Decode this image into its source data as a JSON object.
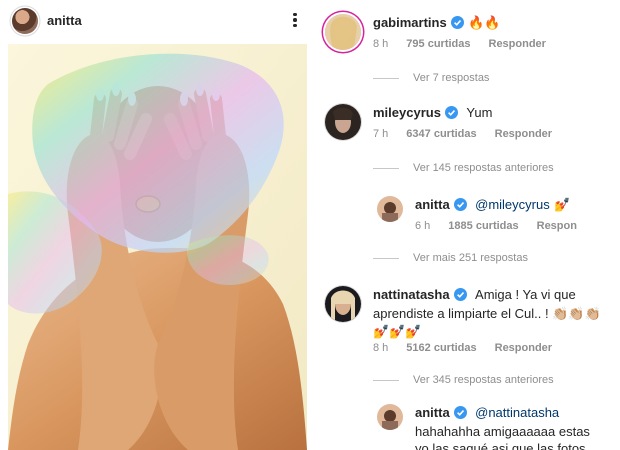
{
  "post": {
    "username": "anitta",
    "photo_alt": "anitta photo"
  },
  "comments": [
    {
      "username": "gabimartins",
      "text": "🔥🔥",
      "time": "8 h",
      "likes": "795 curtidas",
      "reply_label": "Responder",
      "view_replies": "Ver 7 respostas"
    },
    {
      "username": "mileycyrus",
      "text": "Yum",
      "time": "7 h",
      "likes": "6347 curtidas",
      "reply_label": "Responder",
      "view_replies": "Ver 145 respostas anteriores"
    },
    {
      "username": "anitta",
      "mention": "@mileycyrus",
      "text": "💅",
      "time": "6 h",
      "likes": "1885 curtidas",
      "reply_label": "Respon",
      "view_replies": "Ver mais 251 respostas"
    },
    {
      "username": "nattinatasha",
      "text_line1": "Amiga ! Ya vi que",
      "text_line2": "aprendiste a limpiarte el Cul.. ! 👏🏼👏🏼👏🏼",
      "text_line3": "💅💅💅",
      "time": "8 h",
      "likes": "5162 curtidas",
      "reply_label": "Responder",
      "view_replies": "Ver 345 respostas anteriores"
    },
    {
      "username": "anitta",
      "mention": "@nattinatasha",
      "text_line1": "hahahahha amigaaaaaa estas",
      "text_line2": "yo las saqué asi que las fotos"
    }
  ],
  "colors": {
    "verified_blue": "#3897f0",
    "secondary_text": "#8e8e8e",
    "mention": "#00376b"
  }
}
